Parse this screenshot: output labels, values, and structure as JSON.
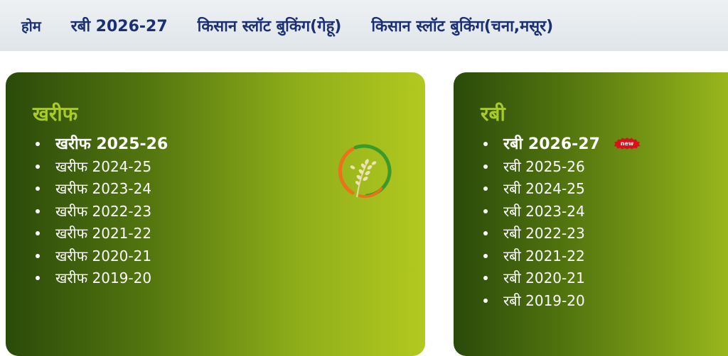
{
  "nav": {
    "items": [
      {
        "label": "होम"
      },
      {
        "label": "रबी 2026-27"
      },
      {
        "label": "किसान स्लॉट बुकिंग(गेहू)"
      },
      {
        "label": "किसान स्लॉट बुकिंग(चना,मसूर)"
      }
    ]
  },
  "kharif": {
    "title": "खरीफ",
    "items": [
      {
        "label": "खरीफ 2025-26"
      },
      {
        "label": "खरीफ 2024-25"
      },
      {
        "label": "खरीफ 2023-24"
      },
      {
        "label": "खरीफ 2022-23"
      },
      {
        "label": "खरीफ 2021-22"
      },
      {
        "label": "खरीफ 2020-21"
      },
      {
        "label": "खरीफ 2019-20"
      }
    ]
  },
  "rabi": {
    "title": "रबी",
    "new_badge": "new",
    "items": [
      {
        "label": "रबी 2026-27"
      },
      {
        "label": "रबी 2025-26"
      },
      {
        "label": "रबी 2024-25"
      },
      {
        "label": "रबी 2023-24"
      },
      {
        "label": "रबी 2022-23"
      },
      {
        "label": "रबी 2021-22"
      },
      {
        "label": "रबी 2020-21"
      },
      {
        "label": "रबी 2019-20"
      }
    ]
  },
  "colors": {
    "nav_text": "#1b2f74",
    "panel_dark": "#2a4a0a",
    "panel_light": "#b3c920",
    "panel_title": "#a8cb28",
    "badge_red": "#d8121a"
  },
  "icons": {
    "logo": "wheat-emblem-icon",
    "badge": "new-badge-icon"
  }
}
